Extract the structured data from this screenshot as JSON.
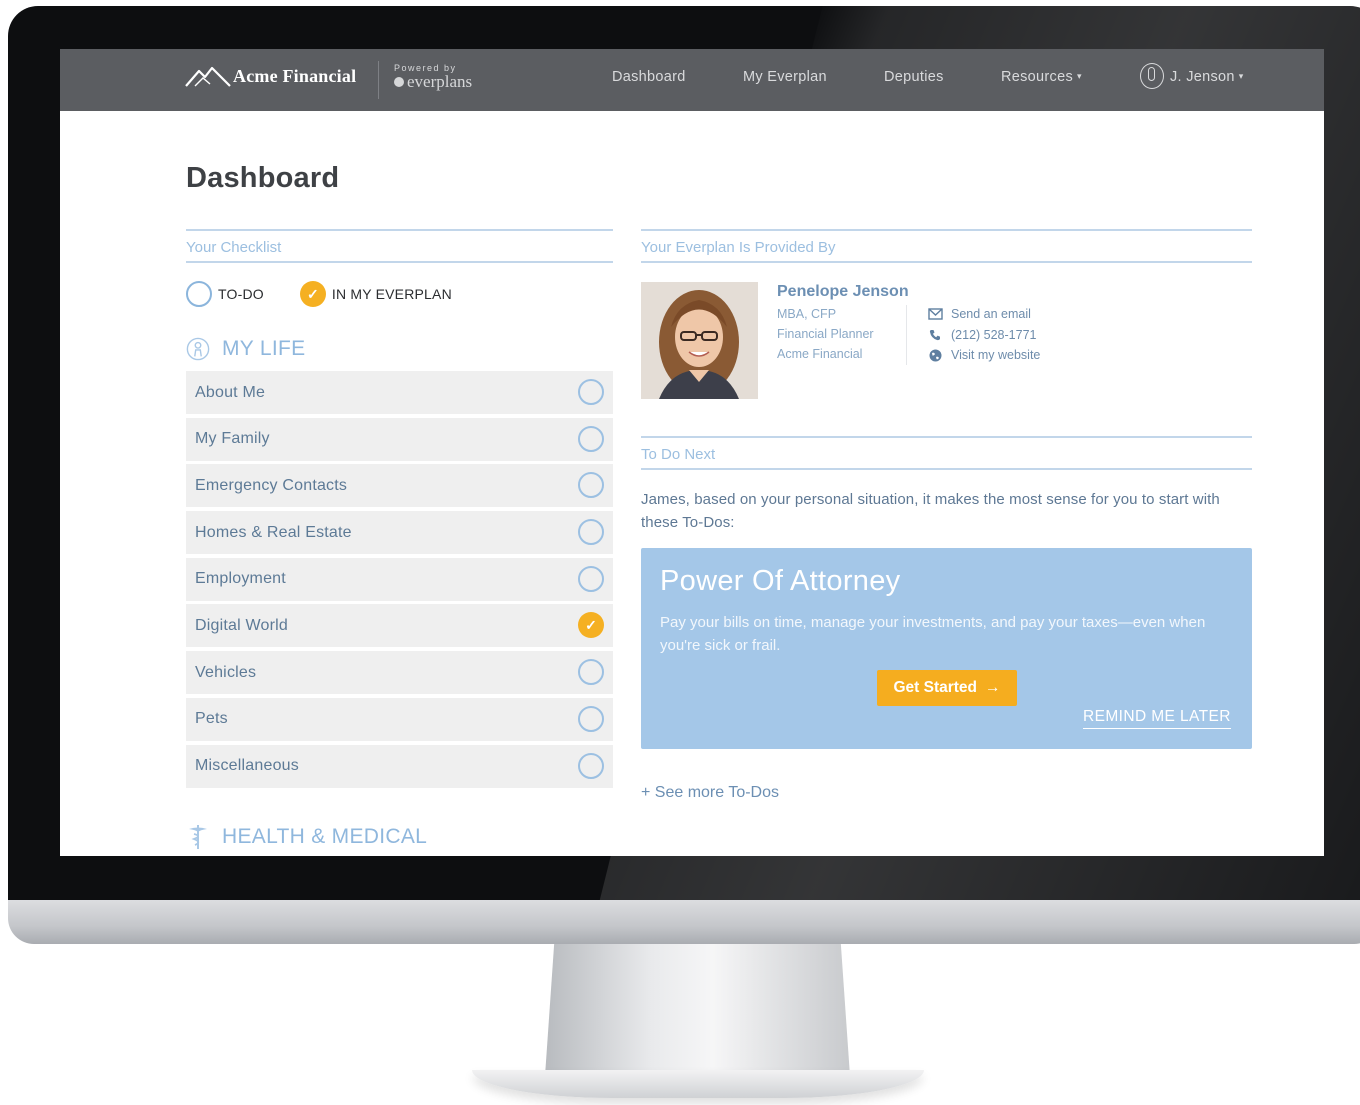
{
  "navbar": {
    "brand": "Acme Financial",
    "powered_by": "Powered by",
    "powered_brand": "everplans",
    "links": [
      "Dashboard",
      "My Everplan",
      "Deputies",
      "Resources"
    ],
    "user": "J. Jenson",
    "caret": "▾"
  },
  "page": {
    "title": "Dashboard"
  },
  "checklist": {
    "heading": "Your Checklist",
    "legend": {
      "todo": "TO-DO",
      "done": "IN MY EVERPLAN"
    },
    "category": "MY LIFE",
    "items": [
      {
        "label": "About Me",
        "done": false
      },
      {
        "label": "My Family",
        "done": false
      },
      {
        "label": "Emergency Contacts",
        "done": false
      },
      {
        "label": "Homes & Real Estate",
        "done": false
      },
      {
        "label": "Employment",
        "done": false
      },
      {
        "label": "Digital World",
        "done": true
      },
      {
        "label": "Vehicles",
        "done": false
      },
      {
        "label": "Pets",
        "done": false
      },
      {
        "label": "Miscellaneous",
        "done": false
      }
    ],
    "next_category": "HEALTH & MEDICAL"
  },
  "provider": {
    "heading": "Your Everplan Is Provided By",
    "name": "Penelope Jenson",
    "credentials": "MBA, CFP",
    "role": "Financial Planner",
    "company": "Acme Financial",
    "email_label": "Send an email",
    "phone": "(212) 528-1771",
    "website_label": "Visit my website"
  },
  "todo": {
    "heading": "To Do Next",
    "intro": "James, based on your personal situation, it makes the most sense for you to start with these To-Dos:",
    "card_title": "Power Of Attorney",
    "card_desc": "Pay your bills on time, manage your investments, and pay your taxes—even when you're sick or frail.",
    "cta": "Get Started",
    "cta_arrow": "→",
    "remind": "REMIND ME LATER",
    "see_more": "+ See more To-Dos"
  },
  "colors": {
    "navbar": "#5b5d61",
    "accent_blue": "#a4c7e8",
    "accent_orange": "#f5ad1f"
  }
}
